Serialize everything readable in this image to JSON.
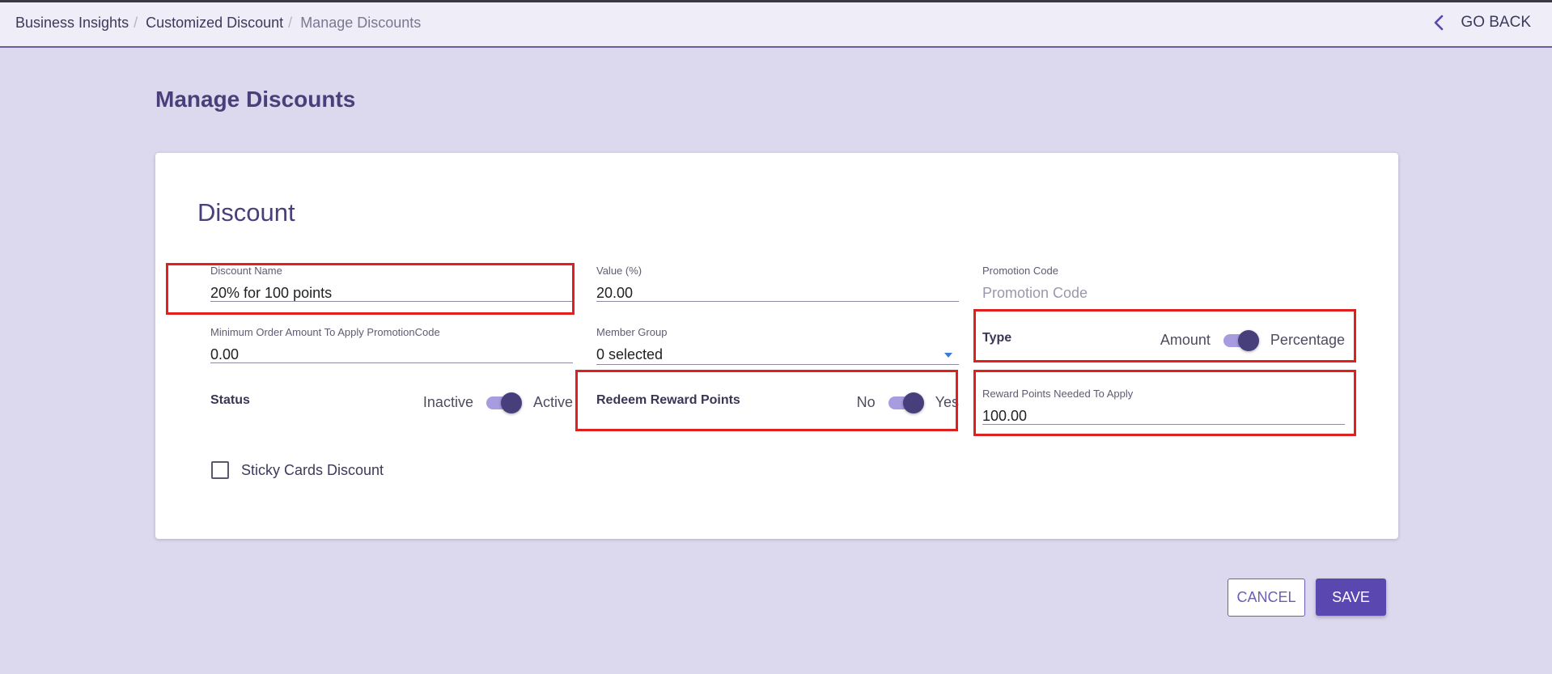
{
  "breadcrumb": {
    "items": [
      "Business Insights",
      "Customized Discount",
      "Manage Discounts"
    ],
    "separator": "/"
  },
  "header": {
    "go_back_label": "GO BACK",
    "go_back_icon": "chevron-left-icon"
  },
  "page_title": "Manage Discounts",
  "card": {
    "title": "Discount",
    "fields": {
      "discount_name": {
        "label": "Discount Name",
        "value": "20% for 100 points"
      },
      "value_pct": {
        "label": "Value (%)",
        "value": "20.00"
      },
      "promotion_code": {
        "label": "Promotion Code",
        "placeholder": "Promotion Code"
      },
      "min_order": {
        "label": "Minimum Order Amount To Apply PromotionCode",
        "value": "0.00"
      },
      "member_group": {
        "label": "Member Group",
        "value": "0 selected"
      },
      "reward_points": {
        "label": "Reward Points Needed To Apply",
        "value": "100.00"
      }
    },
    "toggles": {
      "type": {
        "label": "Type",
        "off": "Amount",
        "on": "Percentage",
        "state": "on"
      },
      "status": {
        "label": "Status",
        "off": "Inactive",
        "on": "Active",
        "state": "on"
      },
      "redeem": {
        "label": "Redeem Reward Points",
        "off": "No",
        "on": "Yes",
        "state": "on"
      }
    },
    "sticky_cards": {
      "label": "Sticky Cards Discount",
      "checked": false
    }
  },
  "buttons": {
    "cancel": "CANCEL",
    "save": "SAVE"
  },
  "colors": {
    "accent": "#5a48b0",
    "toggle_thumb": "#473f7c",
    "toggle_track": "#a99be0",
    "highlight": "#e01f1f",
    "background": "#dcd8ed"
  }
}
